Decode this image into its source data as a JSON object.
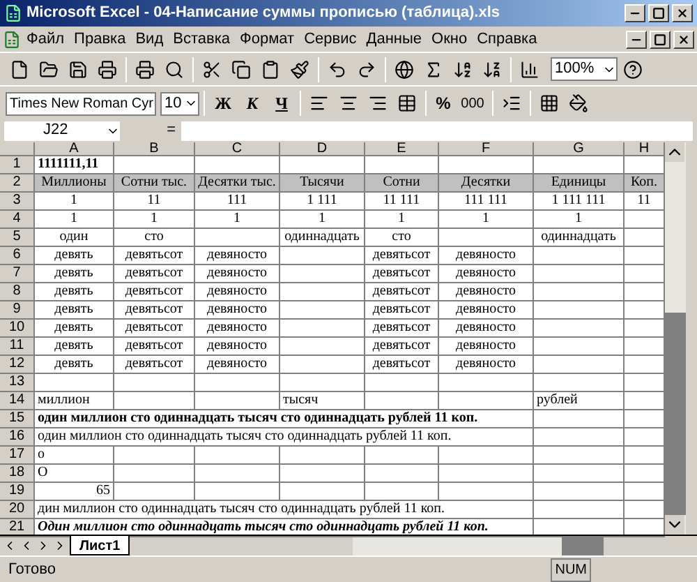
{
  "window": {
    "title": "Microsoft Excel - 04-Написание суммы прописью (таблица).xls"
  },
  "menu": [
    "Файл",
    "Правка",
    "Вид",
    "Вставка",
    "Формат",
    "Сервис",
    "Данные",
    "Окно",
    "Справка"
  ],
  "toolbar": {
    "zoom": "100%"
  },
  "format_bar": {
    "font": "Times New Roman Cyr",
    "size": "10",
    "bold": "Ж",
    "italic": "К",
    "underline": "Ч",
    "percent": "%",
    "thousands": "000"
  },
  "formula_bar": {
    "cell": "J22",
    "equals": "="
  },
  "columns": [
    "A",
    "B",
    "C",
    "D",
    "E",
    "F",
    "G",
    "H"
  ],
  "rows": [
    {
      "number": "1",
      "kind": "bold",
      "cells": [
        "1111111,11"
      ]
    },
    {
      "number": "2",
      "kind": "header",
      "cells": [
        "Миллионы",
        "Сотни тыс.",
        "Десятки тыс.",
        "Тысячи",
        "Сотни",
        "Десятки",
        "Единицы",
        "Коп."
      ]
    },
    {
      "number": "3",
      "kind": "centered",
      "cells": [
        "1",
        "11",
        "111",
        "1 111",
        "11 111",
        "111 111",
        "1 111 111",
        "11"
      ]
    },
    {
      "number": "4",
      "kind": "centered",
      "cells": [
        "1",
        "1",
        "1",
        "1",
        "1",
        "1",
        "1"
      ]
    },
    {
      "number": "5",
      "kind": "centered",
      "cells": [
        "один",
        "сто",
        null,
        "одиннадцать",
        "сто",
        null,
        "одиннадцать"
      ]
    },
    {
      "number": "6",
      "kind": "centered",
      "cells": [
        "девять",
        "девятьсот",
        "девяносто",
        null,
        "девятьсот",
        "девяносто"
      ]
    },
    {
      "number": "7",
      "kind": "centered",
      "cells": [
        "девять",
        "девятьсот",
        "девяносто",
        null,
        "девятьсот",
        "девяносто"
      ]
    },
    {
      "number": "8",
      "kind": "centered",
      "cells": [
        "девять",
        "девятьсот",
        "девяносто",
        null,
        "девятьсот",
        "девяносто"
      ]
    },
    {
      "number": "9",
      "kind": "centered",
      "cells": [
        "девять",
        "девятьсот",
        "девяносто",
        null,
        "девятьсот",
        "девяносто"
      ]
    },
    {
      "number": "10",
      "kind": "centered",
      "cells": [
        "девять",
        "девятьсот",
        "девяносто",
        null,
        "девятьсот",
        "девяносто"
      ]
    },
    {
      "number": "11",
      "kind": "centered",
      "cells": [
        "девять",
        "девятьсот",
        "девяносто",
        null,
        "девятьсот",
        "девяносто"
      ]
    },
    {
      "number": "12",
      "kind": "centered",
      "cells": [
        "девять",
        "девятьсот",
        "девяносто",
        null,
        "девятьсот",
        "девяносто"
      ]
    },
    {
      "number": "13",
      "kind": "centered",
      "cells": []
    },
    {
      "number": "14",
      "kind": "left",
      "cells": [
        "миллион",
        null,
        null,
        "тысяч",
        null,
        null,
        "рублей"
      ]
    },
    {
      "number": "15",
      "kind": "long_bold",
      "cells": [
        "один миллион сто  одиннадцать тысяч сто  одиннадцать рублей 11  коп."
      ]
    },
    {
      "number": "16",
      "kind": "long",
      "cells": [
        "один миллион сто одиннадцать тысяч сто одиннадцать рублей 11 коп."
      ]
    },
    {
      "number": "17",
      "kind": "left",
      "cells": [
        "о"
      ]
    },
    {
      "number": "18",
      "kind": "left",
      "cells": [
        "О"
      ]
    },
    {
      "number": "19",
      "kind": "number",
      "cells": [
        "65"
      ]
    },
    {
      "number": "20",
      "kind": "long",
      "cells": [
        "дин миллион сто одиннадцать тысяч сто одиннадцать рублей 11 коп."
      ]
    },
    {
      "number": "21",
      "kind": "long_bold_italic",
      "cells": [
        "Один миллион сто одиннадцать тысяч сто одиннадцать рублей 11 коп."
      ]
    }
  ],
  "sheet_tabs": [
    {
      "label": "Лист1",
      "selected": true
    }
  ],
  "status_bar": {
    "text": "Готово",
    "num": "NUM"
  }
}
